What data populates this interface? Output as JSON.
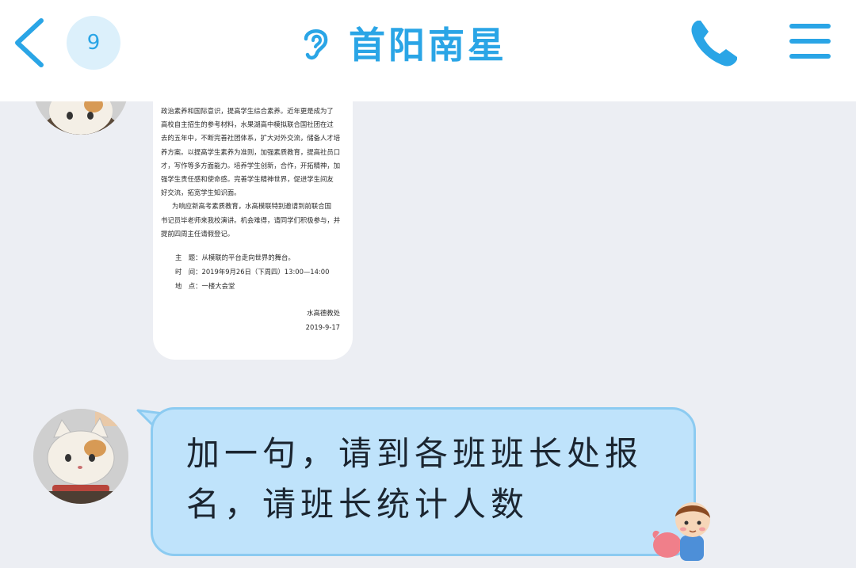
{
  "header": {
    "unread_count": "9",
    "title": "首阳南星"
  },
  "colors": {
    "accent": "#2aa5e6",
    "badge_bg": "#dcf0fb",
    "chat_bg": "#eceef3",
    "bubble_bg": "#bfe3fb",
    "bubble_border": "#8ccbf1"
  },
  "icons": [
    "back-arrow-icon",
    "ear-icon",
    "phone-icon",
    "menu-icon"
  ],
  "messages": [
    {
      "type": "image",
      "notice": {
        "body_lines": [
          "政治素养和国际意识，提高学生综合素养。近年更是成为了",
          "高校自主招生的参考材料，水果湖高中模拟联合国社团在过",
          "去的五年中，不断完善社团体系，扩大对外交流，储备人才培",
          "养方案。以提高学生素养为准则，加强素质教育，提高社员口",
          "才，写作等多方面能力。培养学生创新，合作，开拓精神，加",
          "强学生责任感和使命感。完善学生精神世界，促进学生间友",
          "好交流，拓宽学生知识面。"
        ],
        "para2_lines": [
          "为响应新高考素质教育，水高模联特别邀请到前联合国",
          "书记员毕老师来我校演讲。机会难得，请同学们积极参与，并",
          "提前四周主任请假登记。"
        ],
        "fields": [
          "主　题：从模联的平台走向世界的舞台。",
          "时　间：2019年9月26日（下周四）13:00—14:00",
          "地　点：一楼大会堂"
        ],
        "signature": "水高德教处",
        "date": "2019-9-17"
      }
    },
    {
      "type": "text",
      "text": "加一句，请到各班班长处报\n名，请班长统计人数"
    }
  ]
}
